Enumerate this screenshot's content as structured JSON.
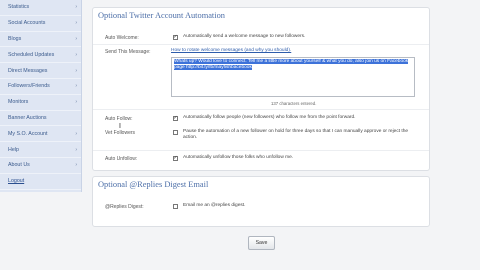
{
  "sidebar": {
    "items": [
      {
        "label": "Statistics",
        "has_arrow": true
      },
      {
        "label": "Social Accounts",
        "has_arrow": true
      },
      {
        "label": "Blogs",
        "has_arrow": true
      },
      {
        "label": "Scheduled Updates",
        "has_arrow": true
      },
      {
        "label": "Direct Messages",
        "has_arrow": true
      },
      {
        "label": "Followers/Friends",
        "has_arrow": true
      },
      {
        "label": "Monitors",
        "has_arrow": true
      },
      {
        "label": "Banner Auctions",
        "has_arrow": false
      },
      {
        "label": "My S.O. Account",
        "has_arrow": true
      },
      {
        "label": "Help",
        "has_arrow": true
      },
      {
        "label": "About Us",
        "has_arrow": true
      },
      {
        "label": "Logout",
        "has_arrow": false
      }
    ],
    "arrow_glyph": "›"
  },
  "automation": {
    "title": "Optional Twitter Account Automation",
    "auto_welcome": {
      "label": "Auto Welcome:",
      "checked": true,
      "text": "Automatically send a welcome message to new followers."
    },
    "send_message": {
      "label": "Send This Message:",
      "help_link": "How to rotate welcome messages (and why you should).",
      "value": "Whats up? Would love to connect. Tell me a little more about yourself & what you do, also join us on Facebook page http://bit.ly/fb/mayfishbacebook",
      "char_count": "137 characters entered."
    },
    "auto_follow": {
      "label": "Auto Follow:",
      "checked": true,
      "text": "Automatically follow people (new followers) who follow me from the point forward."
    },
    "vet_followers": {
      "label": "Vet Followers",
      "checked": false,
      "text": "Pause the automation of a new follower on hold for three days so that I can manually approve or reject the action."
    },
    "auto_unfollow": {
      "label": "Auto Unfollow:",
      "checked": true,
      "text": "Automatically unfollow those folks who unfollow me."
    }
  },
  "digest": {
    "title": "Optional @Replies Digest Email",
    "label": "@Replies Digest:",
    "checked": false,
    "text": "Email me an @replies digest."
  },
  "save_label": "Save",
  "check_glyph": "✓"
}
